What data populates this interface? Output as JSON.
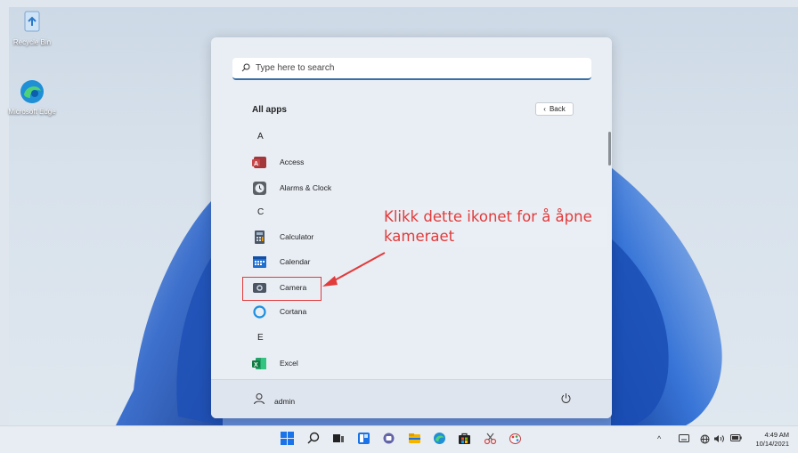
{
  "desktop": {
    "icons": [
      {
        "label": "Recycle Bin"
      },
      {
        "label": "Microsoft Edge"
      }
    ]
  },
  "start_menu": {
    "search": {
      "placeholder": "Type here to search"
    },
    "all_apps_title": "All apps",
    "back_label": "Back",
    "letters": [
      "A",
      "C",
      "E"
    ],
    "apps": [
      {
        "label": "Access",
        "icon": "access-icon"
      },
      {
        "label": "Alarms & Clock",
        "icon": "alarm-clock-icon"
      },
      {
        "label": "Calculator",
        "icon": "calculator-icon"
      },
      {
        "label": "Calendar",
        "icon": "calendar-icon"
      },
      {
        "label": "Camera",
        "icon": "camera-icon"
      },
      {
        "label": "Cortana",
        "icon": "cortana-icon"
      },
      {
        "label": "Excel",
        "icon": "excel-icon"
      }
    ],
    "user": {
      "name": "admin"
    }
  },
  "annotation": {
    "text": "Klikk dette ikonet for å åpne kameraet",
    "color": "#e23b3b"
  },
  "taskbar": {
    "icons": [
      "start-icon",
      "search-icon",
      "task-view-icon",
      "widgets-icon",
      "chat-icon",
      "file-explorer-icon",
      "edge-icon",
      "store-icon",
      "snip-icon",
      "paint-icon"
    ],
    "clock": {
      "time": "4:49 AM",
      "date": "10/14/2021"
    }
  },
  "colors": {
    "accent": "#0067c0",
    "annotation": "#e23b3b"
  }
}
